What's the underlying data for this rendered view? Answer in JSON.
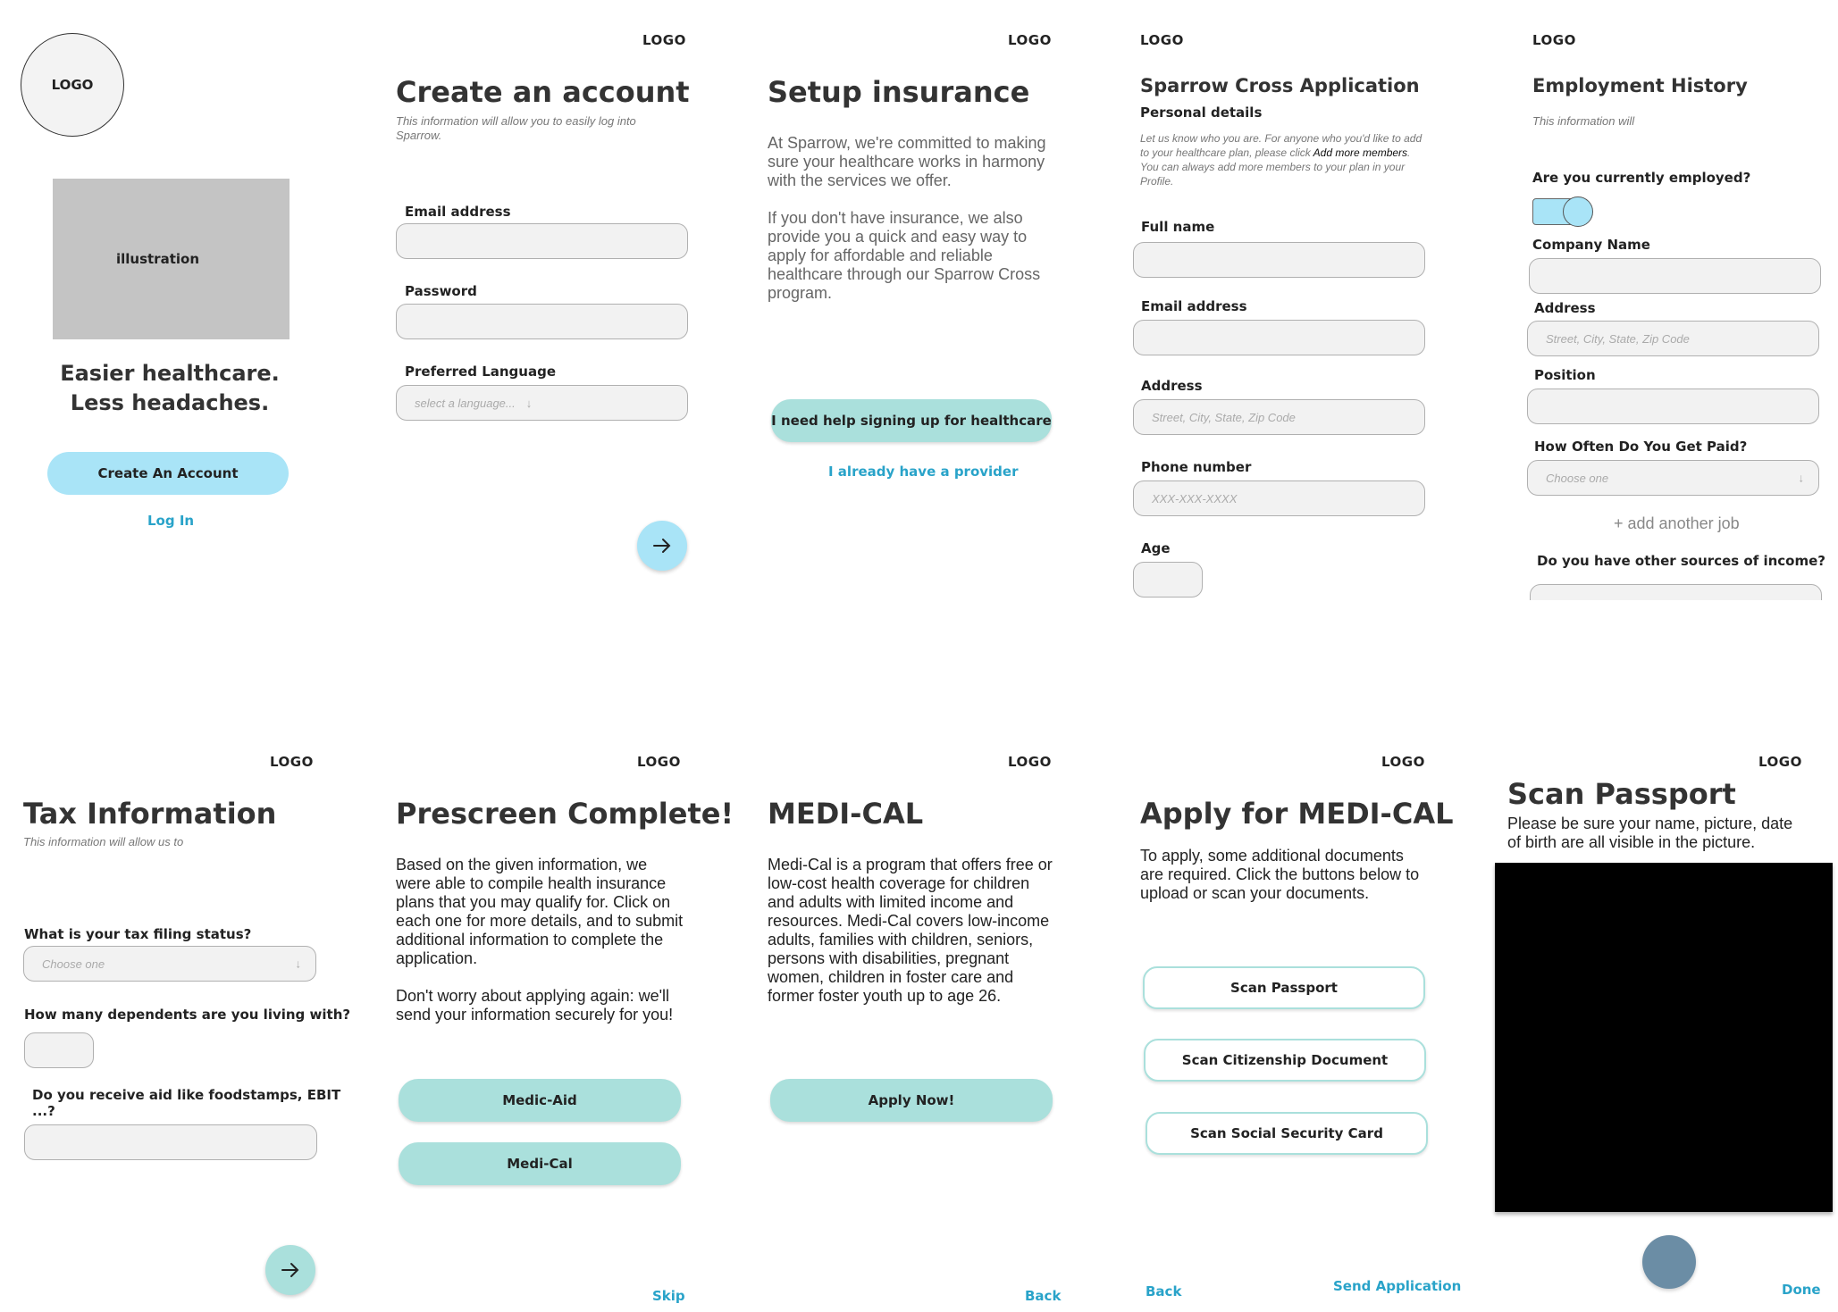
{
  "colors": {
    "accent_blue": "#a9e4f7",
    "teal": "#aae0dc",
    "link": "#29a3c9",
    "camera_button": "#6b8da5"
  },
  "s1": {
    "logo": "LOGO",
    "illustration": "illustration",
    "headline1": "Easier healthcare.",
    "headline2": "Less headaches.",
    "create_button": "Create An Account",
    "login_link": "Log In"
  },
  "s2": {
    "logo": "LOGO",
    "title": "Create an account",
    "subtitle": "This information will allow you to easily log into Sparrow.",
    "email_label": "Email address",
    "password_label": "Password",
    "language_label": "Preferred Language",
    "language_placeholder": "select a language...",
    "next_icon": "arrow-right-icon"
  },
  "s3": {
    "logo": "LOGO",
    "title": "Setup insurance",
    "para1": "At Sparrow, we're committed to making sure your healthcare works in harmony with the services we offer.",
    "para2": "If you don't have insurance, we also provide you a quick and easy way to apply for affordable and reliable healthcare through our Sparrow Cross program.",
    "help_button": "I need help signing up for healthcare",
    "provider_link": "I already have a provider"
  },
  "s4": {
    "logo": "LOGO",
    "title": "Sparrow Cross Application",
    "section": "Personal details",
    "intro_a": "Let us know who you are. For anyone who you'd like to add to your healthcare plan, please click ",
    "intro_link": "Add more members",
    "intro_b": ". You can always add more members to your plan in your Profile.",
    "full_name_label": "Full name",
    "email_label": "Email address",
    "address_label": "Address",
    "address_placeholder": "Street, City, State, Zip Code",
    "phone_label": "Phone number",
    "phone_placeholder": "XXX-XXX-XXXX",
    "age_label": "Age"
  },
  "s5": {
    "logo": "LOGO",
    "title": "Employment History",
    "subtitle": "This information will",
    "employed_question": "Are you currently employed?",
    "company_label": "Company Name",
    "address_label": "Address",
    "address_placeholder": "Street, City, State, Zip Code",
    "position_label": "Position",
    "paid_label": "How Often Do You Get Paid?",
    "paid_placeholder": "Choose one",
    "add_job": "+ add another job",
    "income_question": "Do you have other sources of income?"
  },
  "s6": {
    "logo": "LOGO",
    "title": "Tax Information",
    "subtitle": "This information will allow us to",
    "filing_label": "What is your tax filing status?",
    "filing_placeholder": "Choose one",
    "dependents_label": "How many dependents are you living with?",
    "aid_label_1": "Do you receive aid like foodstamps, EBIT",
    "aid_label_2": "...?",
    "next_icon": "arrow-right-icon"
  },
  "s7": {
    "logo": "LOGO",
    "title": "Prescreen Complete!",
    "para1": "Based on the given information, we were able to compile health insurance plans that you may qualify for. Click on each one for more details, and to submit additional information to complete the application.",
    "para2": "Don't worry about applying again: we'll send your information securely for you!",
    "plan1": "Medic-Aid",
    "plan2": "Medi-Cal",
    "skip": "Skip"
  },
  "s8": {
    "logo": "LOGO",
    "title": "MEDI-CAL",
    "para": "Medi-Cal is a program that offers free or low-cost health coverage for children and adults with limited income and resources. Medi-Cal covers low-income adults, families with children, seniors, persons with disabilities, pregnant women, children in foster care and former foster youth up to age 26.",
    "apply_button": "Apply Now!",
    "back": "Back"
  },
  "s9": {
    "logo": "LOGO",
    "title": "Apply for MEDI-CAL",
    "para": "To apply, some additional documents are required. Click the buttons below to upload or scan your documents.",
    "btn1": "Scan Passport",
    "btn2": "Scan Citizenship Document",
    "btn3": "Scan Social Security Card",
    "back": "Back",
    "send": "Send Application"
  },
  "s10": {
    "logo": "LOGO",
    "title": "Scan Passport",
    "para": "Please be sure your name, picture, date of birth are all visible in the picture.",
    "done": "Done"
  }
}
